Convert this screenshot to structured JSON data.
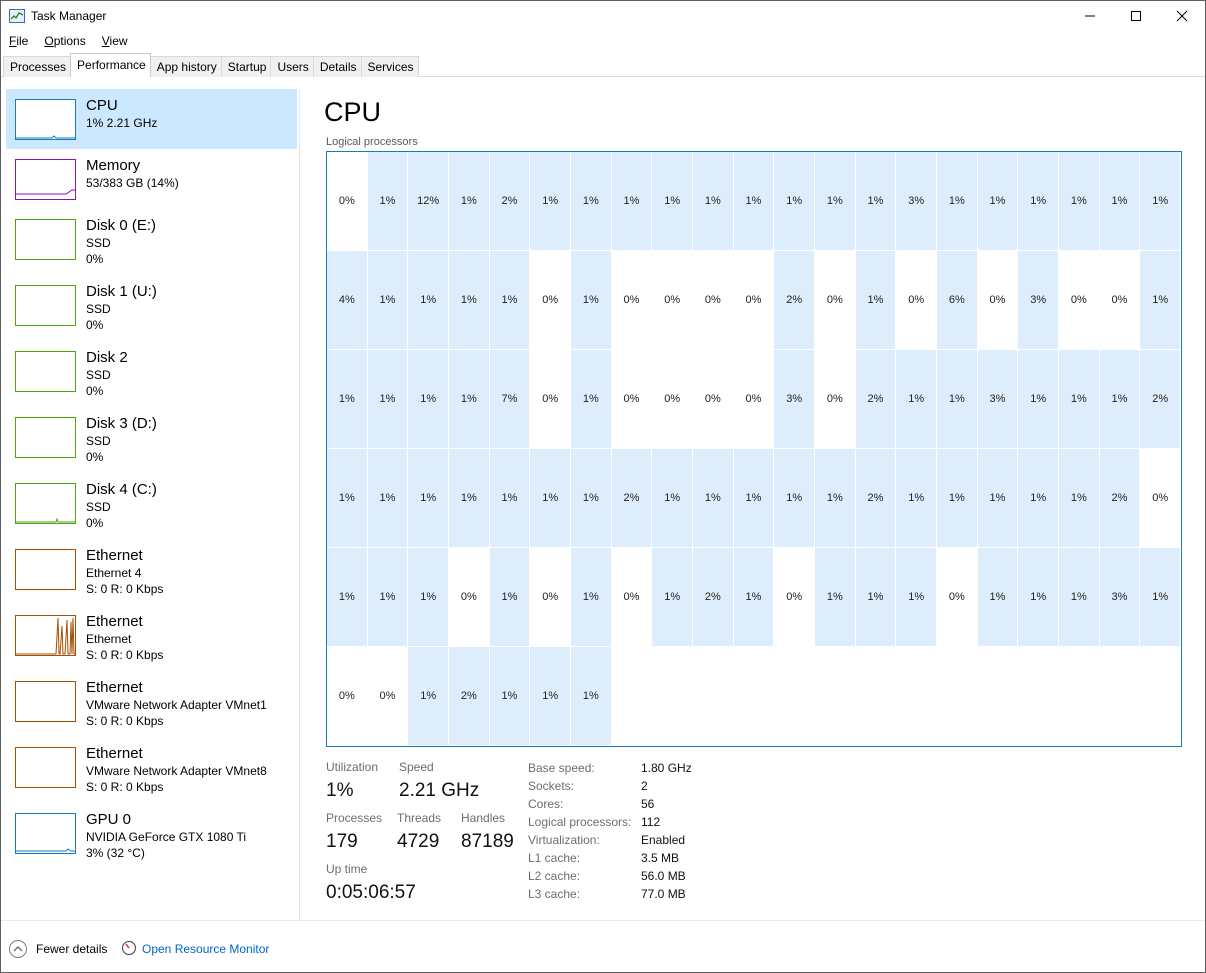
{
  "window": {
    "title": "Task Manager"
  },
  "menu": [
    {
      "label": "File",
      "accel": "F",
      "rest": "ile"
    },
    {
      "label": "Options",
      "accel": "O",
      "rest": "ptions"
    },
    {
      "label": "View",
      "accel": "V",
      "rest": "iew"
    }
  ],
  "tabs": [
    "Processes",
    "Performance",
    "App history",
    "Startup",
    "Users",
    "Details",
    "Services"
  ],
  "active_tab": "Performance",
  "sidebar": {
    "items": [
      {
        "kind": "cpu",
        "title": "CPU",
        "sub": "1% 2.21 GHz",
        "sub2": "",
        "active": true
      },
      {
        "kind": "mem",
        "title": "Memory",
        "sub": "53/383 GB (14%)",
        "sub2": ""
      },
      {
        "kind": "disk",
        "title": "Disk 0 (E:)",
        "sub": "SSD",
        "sub2": "0%"
      },
      {
        "kind": "disk",
        "title": "Disk 1 (U:)",
        "sub": "SSD",
        "sub2": "0%"
      },
      {
        "kind": "disk",
        "title": "Disk 2",
        "sub": "SSD",
        "sub2": "0%"
      },
      {
        "kind": "disk",
        "title": "Disk 3 (D:)",
        "sub": "SSD",
        "sub2": "0%"
      },
      {
        "kind": "disk",
        "title": "Disk 4 (C:)",
        "sub": "SSD",
        "sub2": "0%"
      },
      {
        "kind": "eth",
        "title": "Ethernet",
        "sub": "Ethernet 4",
        "sub2": "S: 0 R: 0 Kbps"
      },
      {
        "kind": "eth",
        "title": "Ethernet",
        "sub": "Ethernet",
        "sub2": "S: 0 R: 0 Kbps"
      },
      {
        "kind": "eth",
        "title": "Ethernet",
        "sub": "VMware Network Adapter VMnet1",
        "sub2": "S: 0 R: 0 Kbps"
      },
      {
        "kind": "eth",
        "title": "Ethernet",
        "sub": "VMware Network Adapter VMnet8",
        "sub2": "S: 0 R: 0 Kbps"
      },
      {
        "kind": "gpu",
        "title": "GPU 0",
        "sub": "NVIDIA GeForce GTX 1080 Ti",
        "sub2": "3% (32 °C)"
      }
    ]
  },
  "main": {
    "title": "CPU",
    "grid_label": "Logical processors",
    "logical_processors": [
      "0%",
      "1%",
      "12%",
      "1%",
      "2%",
      "1%",
      "1%",
      "1%",
      "1%",
      "1%",
      "1%",
      "1%",
      "1%",
      "1%",
      "3%",
      "1%",
      "1%",
      "1%",
      "1%",
      "1%",
      "1%",
      "4%",
      "1%",
      "1%",
      "1%",
      "1%",
      "0%",
      "1%",
      "0%",
      "0%",
      "0%",
      "0%",
      "2%",
      "0%",
      "1%",
      "0%",
      "6%",
      "0%",
      "3%",
      "0%",
      "0%",
      "1%",
      "1%",
      "1%",
      "1%",
      "1%",
      "7%",
      "0%",
      "1%",
      "0%",
      "0%",
      "0%",
      "0%",
      "3%",
      "0%",
      "2%",
      "1%",
      "1%",
      "3%",
      "1%",
      "1%",
      "1%",
      "2%",
      "1%",
      "1%",
      "1%",
      "1%",
      "1%",
      "1%",
      "1%",
      "2%",
      "1%",
      "1%",
      "1%",
      "1%",
      "1%",
      "2%",
      "1%",
      "1%",
      "1%",
      "1%",
      "1%",
      "2%",
      "0%",
      "1%",
      "1%",
      "1%",
      "0%",
      "1%",
      "0%",
      "1%",
      "0%",
      "1%",
      "2%",
      "1%",
      "0%",
      "1%",
      "1%",
      "1%",
      "0%",
      "1%",
      "1%",
      "1%",
      "3%",
      "1%",
      "0%",
      "0%",
      "1%",
      "2%",
      "1%",
      "1%",
      "1%"
    ],
    "stats": {
      "utilization_label": "Utilization",
      "utilization": "1%",
      "speed_label": "Speed",
      "speed": "2.21 GHz",
      "processes_label": "Processes",
      "processes": "179",
      "threads_label": "Threads",
      "threads": "4729",
      "handles_label": "Handles",
      "handles": "87189",
      "uptime_label": "Up time",
      "uptime": "0:05:06:57"
    },
    "details": [
      {
        "label": "Base speed:",
        "value": "1.80 GHz"
      },
      {
        "label": "Sockets:",
        "value": "2"
      },
      {
        "label": "Cores:",
        "value": "56"
      },
      {
        "label": "Logical processors:",
        "value": "112"
      },
      {
        "label": "Virtualization:",
        "value": "Enabled"
      },
      {
        "label": "L1 cache:",
        "value": "3.5 MB"
      },
      {
        "label": "L2 cache:",
        "value": "56.0 MB"
      },
      {
        "label": "L3 cache:",
        "value": "77.0 MB"
      }
    ]
  },
  "footer": {
    "fewer_details": "Fewer details",
    "fewer_accel": "d",
    "resource_monitor": "Open Resource Monitor"
  },
  "colors": {
    "cpu": "#117dbb",
    "memory": "#8b12ae",
    "disk": "#4da60c",
    "ethernet": "#a74f01",
    "active_fill": "#deedfb",
    "selected_item": "#cce8ff",
    "link": "#0066cc"
  }
}
